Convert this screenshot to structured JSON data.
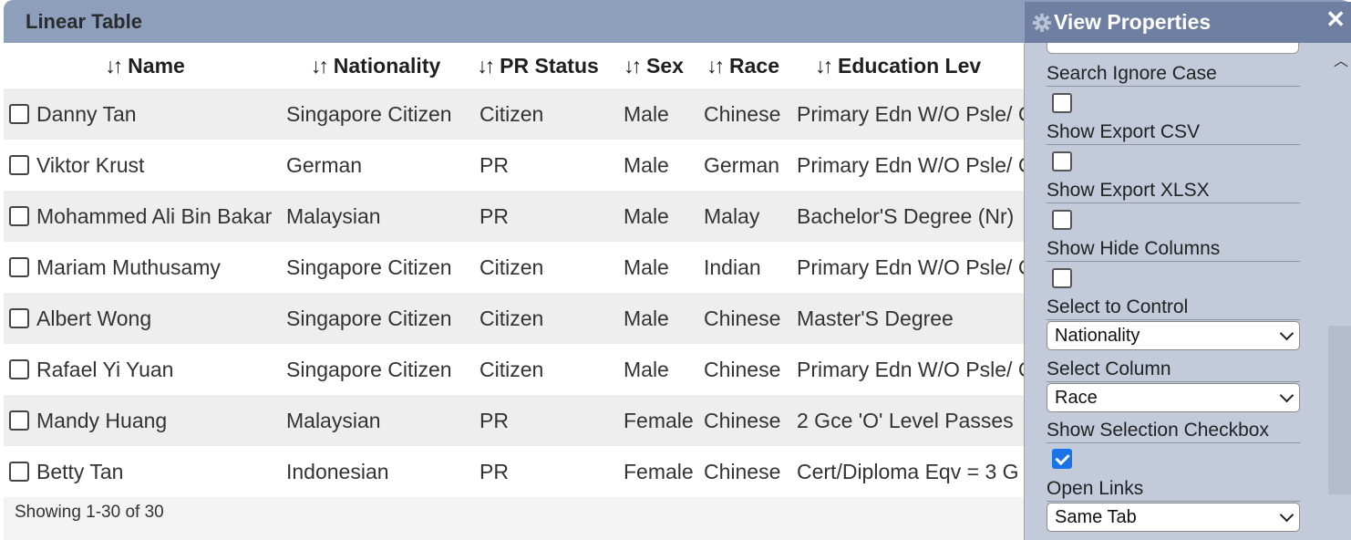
{
  "table": {
    "title": "Linear Table",
    "columns": [
      {
        "label": "Name",
        "sort_icon": "↓↑"
      },
      {
        "label": "Nationality",
        "sort_icon": "↓↑"
      },
      {
        "label": "PR Status",
        "sort_icon": "↓↑"
      },
      {
        "label": "Sex",
        "sort_icon": "↓↑"
      },
      {
        "label": "Race",
        "sort_icon": "↓↑"
      },
      {
        "label": "Education Lev",
        "sort_icon": "↓↑"
      }
    ],
    "rows": [
      {
        "name": "Danny Tan",
        "nationality": "Singapore Citizen",
        "pr_status": "Citizen",
        "sex": "Male",
        "race": "Chinese",
        "education": "Primary Edn W/O Psle/ Cert"
      },
      {
        "name": "Viktor Krust",
        "nationality": "German",
        "pr_status": "PR",
        "sex": "Male",
        "race": "German",
        "education": "Primary Edn W/O Psle/ Cert"
      },
      {
        "name": "Mohammed Ali Bin Bakar",
        "nationality": "Malaysian",
        "pr_status": "PR",
        "sex": "Male",
        "race": "Malay",
        "education": "Bachelor'S Degree (Nr)"
      },
      {
        "name": "Mariam Muthusamy",
        "nationality": "Singapore Citizen",
        "pr_status": "Citizen",
        "sex": "Male",
        "race": "Indian",
        "education": "Primary Edn W/O Psle/ Cert"
      },
      {
        "name": "Albert Wong",
        "nationality": "Singapore Citizen",
        "pr_status": "Citizen",
        "sex": "Male",
        "race": "Chinese",
        "education": "Master'S Degree"
      },
      {
        "name": "Rafael Yi Yuan",
        "nationality": "Singapore Citizen",
        "pr_status": "Citizen",
        "sex": "Male",
        "race": "Chinese",
        "education": "Primary Edn W/O Psle/ Cert"
      },
      {
        "name": "Mandy Huang",
        "nationality": "Malaysian",
        "pr_status": "PR",
        "sex": "Female",
        "race": "Chinese",
        "education": "2 Gce 'O' Level Passes"
      },
      {
        "name": "Betty Tan",
        "nationality": "Indonesian",
        "pr_status": "PR",
        "sex": "Female",
        "race": "Chinese",
        "education": "Cert/Diploma Eqv = 3 G"
      }
    ],
    "footer": "Showing 1-30 of 30"
  },
  "props": {
    "title": "View Properties",
    "close_glyph": "✕",
    "gear_icon": "gear-icon",
    "search_ignore_case": {
      "label": "Search Ignore Case",
      "checked": false
    },
    "show_export_csv": {
      "label": "Show Export CSV",
      "checked": false
    },
    "show_export_xlsx": {
      "label": "Show Export XLSX",
      "checked": false
    },
    "show_hide_columns": {
      "label": "Show Hide Columns",
      "checked": false
    },
    "select_to_control": {
      "label": "Select to Control",
      "value": "Nationality"
    },
    "select_column": {
      "label": "Select Column",
      "value": "Race"
    },
    "show_selection_checkbox": {
      "label": "Show Selection Checkbox",
      "checked": true
    },
    "open_links": {
      "label": "Open Links",
      "value": "Same Tab"
    }
  },
  "colors": {
    "titlebar": "#8e9fbc",
    "props_header": "#6e7fa1",
    "props_bg": "#c3cad9",
    "accent": "#1a73e8"
  }
}
